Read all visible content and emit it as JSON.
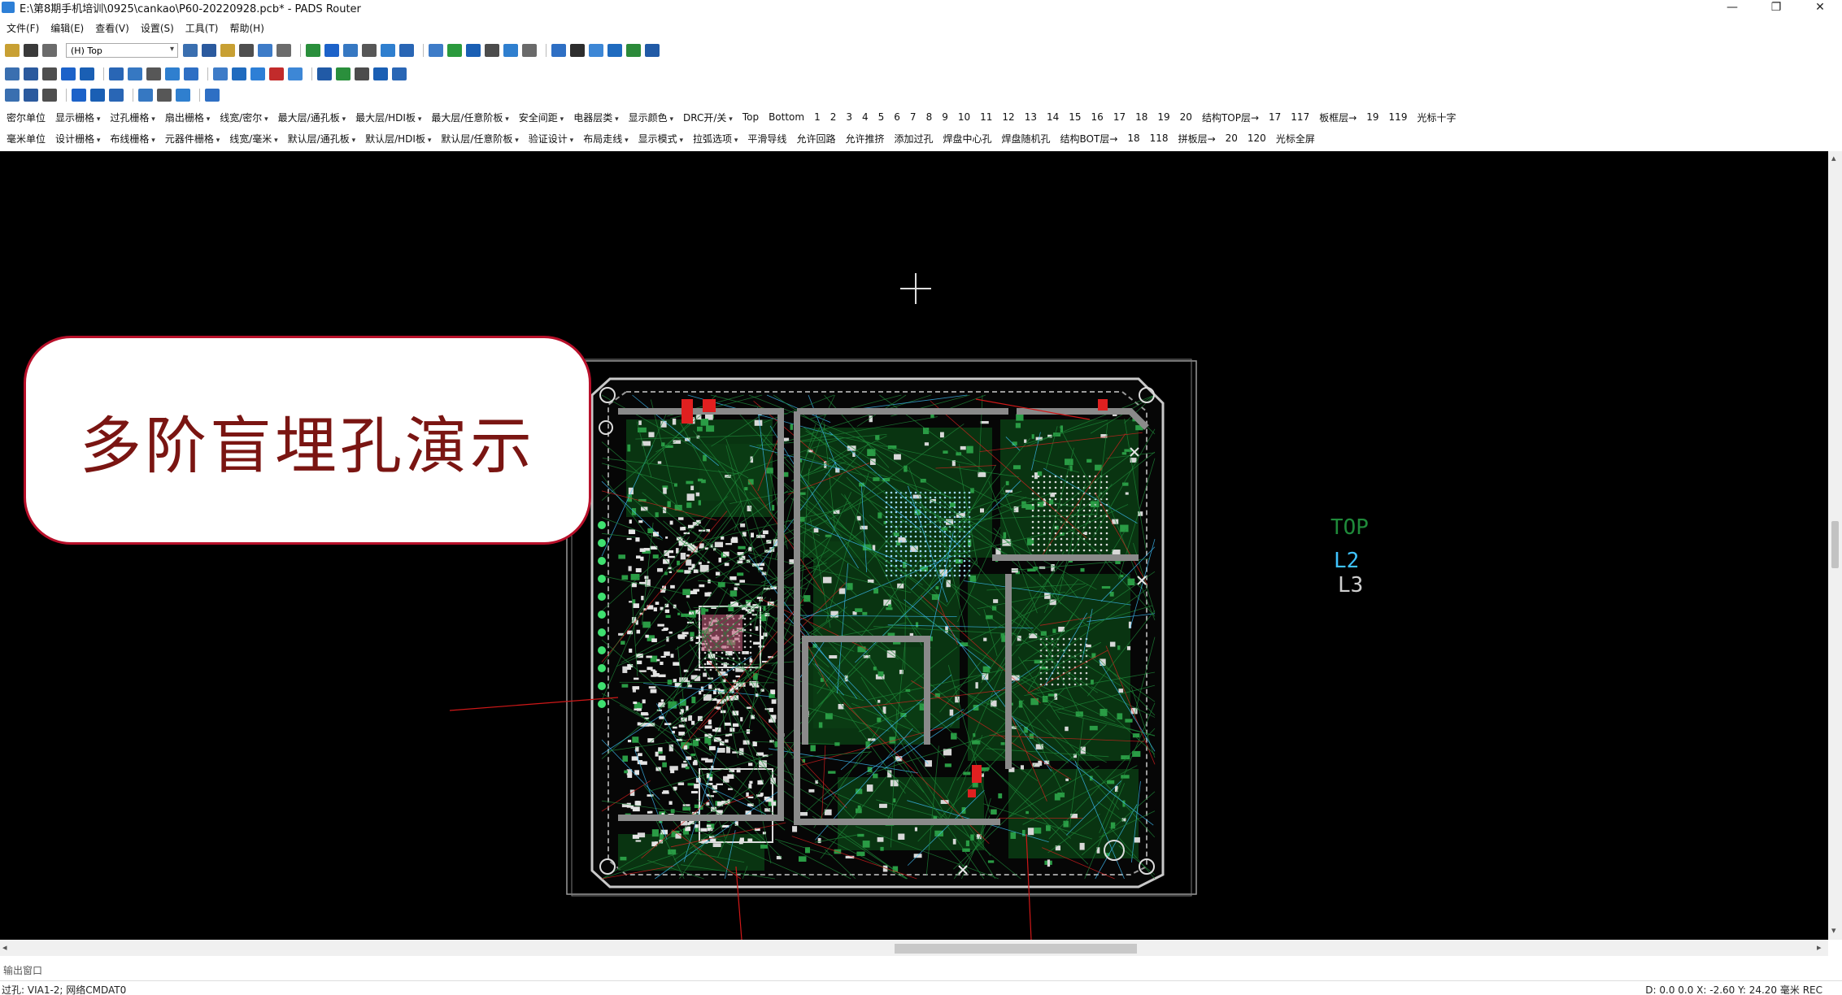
{
  "titlebar": {
    "title": "E:\\第8期手机培训\\0925\\cankao\\P60-20220928.pcb* - PADS Router",
    "minimize": "—",
    "restore": "❐",
    "close": "✕"
  },
  "menu": [
    "文件(F)",
    "编辑(E)",
    "查看(V)",
    "设置(S)",
    "工具(T)",
    "帮助(H)"
  ],
  "layer_select": {
    "value": "(H) Top"
  },
  "toolbar1_colors": [
    "#3a6fb0",
    "#2b5a9e",
    "#c8a033",
    "#4f4f4f",
    "#3e7cc8",
    "#6c6c6c",
    "#2a8f3c",
    "#1c62c9",
    "#3678c2",
    "#575757",
    "#2f7fcf",
    "#2966b5",
    "#3e7cc8",
    "#2b9a3d",
    "#1a5fb4",
    "#4c4c4c",
    "#2f7fcf",
    "#6a6a6a",
    "#2e6fc4",
    "#2d2d2d",
    "#3d87d6",
    "#1f6bbf",
    "#2c8a3a",
    "#215aa6"
  ],
  "toolbar2_colors": [
    "#3a6fb0",
    "#2b5a9e",
    "#4f4f4f",
    "#1c62c9",
    "#1a5fb4",
    "#2966b5",
    "#3678c2",
    "#575757",
    "#2f7fcf",
    "#2e6fc4",
    "#3e7cc8",
    "#1f6bbf",
    "#2d7fd6",
    "#c22b2b",
    "#3d87d6",
    "#215aa6",
    "#2a8f3c",
    "#4c4c4c",
    "#1a5fb4",
    "#2966b5"
  ],
  "toolbar3_colors": [
    "#3a6fb0",
    "#2b5a9e",
    "#4f4f4f",
    "#1c62c9",
    "#1a5fb4",
    "#2966b5",
    "#3678c2",
    "#575757",
    "#2f7fcf",
    "#2e6fc4"
  ],
  "text_toolbar1": [
    "密尔单位",
    "显示栅格",
    "过孔栅格",
    "扇出栅格",
    "线宽/密尔",
    "最大层/通孔板",
    "最大层/HDI板",
    "最大层/任意阶板",
    "安全间距",
    "电器层类",
    "显示颜色",
    "DRC开/关",
    "Top",
    "Bottom",
    "1",
    "2",
    "3",
    "4",
    "5",
    "6",
    "7",
    "8",
    "9",
    "10",
    "11",
    "12",
    "13",
    "14",
    "15",
    "16",
    "17",
    "18",
    "19",
    "20",
    "结构TOP层→",
    "17",
    "117",
    "板框层→",
    "19",
    "119",
    "光标十字"
  ],
  "text_toolbar1_arrows": [
    1,
    2,
    3,
    4,
    5,
    6,
    7,
    8,
    9,
    10,
    11
  ],
  "text_toolbar2": [
    "毫米单位",
    "设计栅格",
    "布线栅格",
    "元器件栅格",
    "线宽/毫米",
    "默认层/通孔板",
    "默认层/HDI板",
    "默认层/任意阶板",
    "验证设计",
    "布局走线",
    "显示模式",
    "拉弧选项",
    "平滑导线",
    "允许回路",
    "允许推挤",
    "添加过孔",
    "焊盘中心孔",
    "焊盘随机孔",
    "结构BOT层→",
    "18",
    "118",
    "拼板层→",
    "20",
    "120",
    "光标全屏"
  ],
  "text_toolbar2_arrows": [
    1,
    2,
    3,
    4,
    5,
    6,
    7,
    8,
    9,
    10,
    11
  ],
  "callout": {
    "text": "多阶盲埋孔演示"
  },
  "layer_labels": [
    {
      "text": "TOP",
      "color": "#1f8a3a"
    },
    {
      "text": "L2",
      "color": "#3fc3ff"
    },
    {
      "text": "L3",
      "color": "#cfcfcf"
    }
  ],
  "output_window": {
    "label": "输出窗口"
  },
  "status": {
    "left": "过孔: VIA1-2; 网络CMDAT0",
    "right": "D: 0.0 0.0  X: -2.60  Y: 24.20  毫米  REC"
  },
  "colors": {
    "canvas": "#000000",
    "board_outline": "#bdbdbd",
    "trace_green": "#1f8a3a",
    "trace_cyan": "#3fc3ff",
    "trace_red": "#e02020",
    "callout_border": "#b8102a",
    "callout_text": "#7a1512"
  }
}
